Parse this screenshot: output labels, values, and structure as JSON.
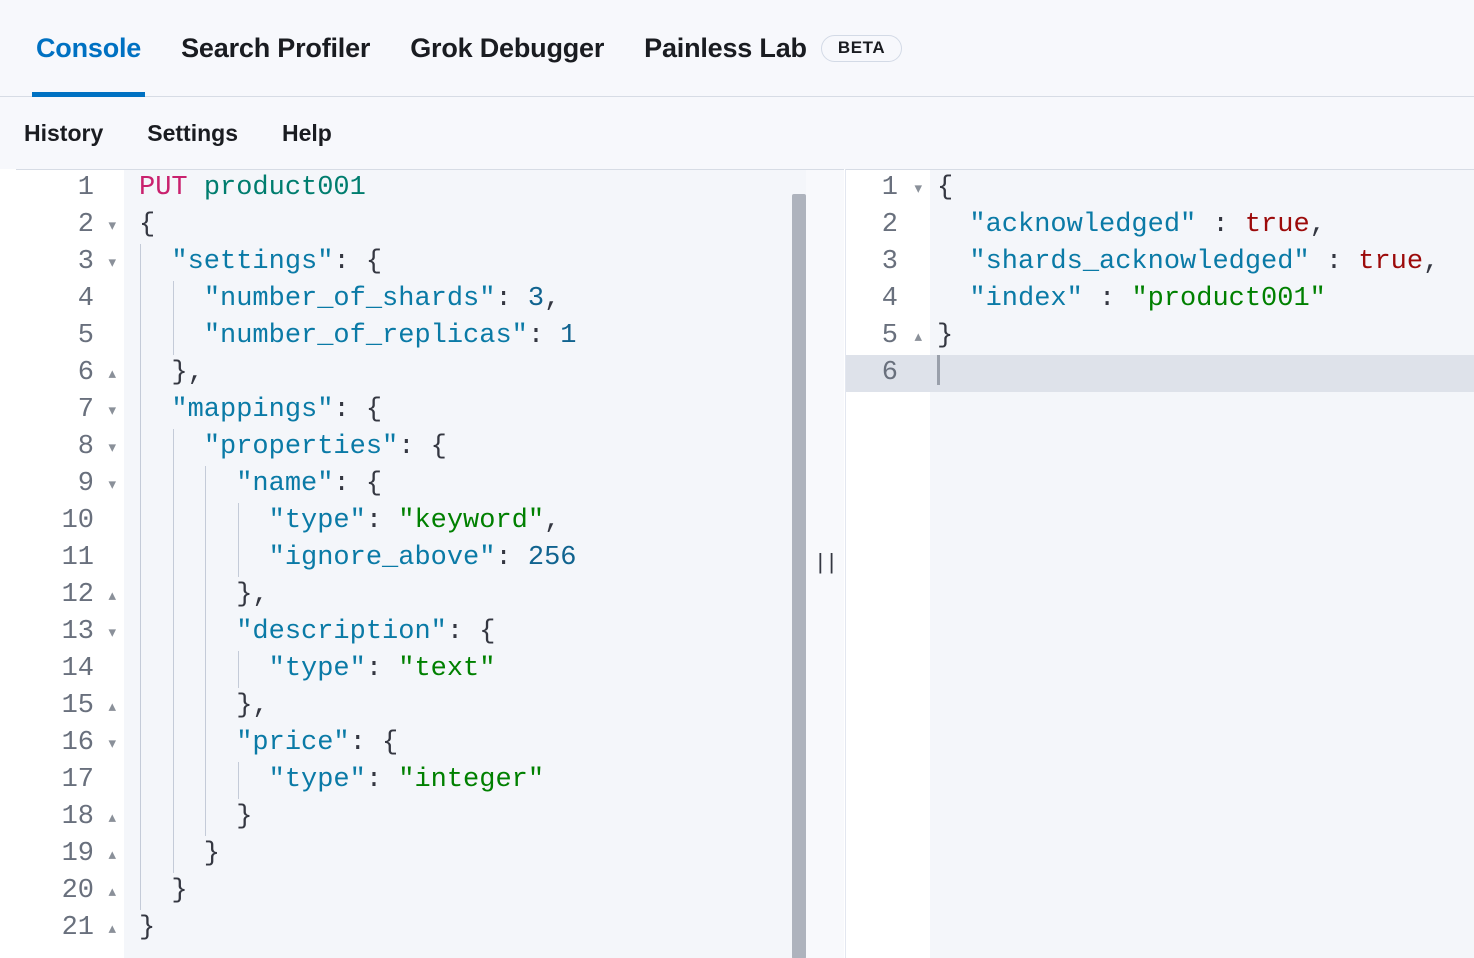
{
  "tabs": [
    {
      "label": "Console",
      "active": true,
      "badge": null
    },
    {
      "label": "Search Profiler",
      "active": false,
      "badge": null
    },
    {
      "label": "Grok Debugger",
      "active": false,
      "badge": null
    },
    {
      "label": "Painless Lab",
      "active": false,
      "badge": "BETA"
    }
  ],
  "subnav": [
    {
      "label": "History"
    },
    {
      "label": "Settings"
    },
    {
      "label": "Help"
    }
  ],
  "colors": {
    "accent": "#0071c2",
    "method": "#c9216e",
    "url": "#007d6e",
    "key": "#0a7aa6",
    "string": "#008000",
    "number": "#10638f",
    "boolean": "#9c0a0a",
    "punctuation": "#343741",
    "editor_background": "#f4f6fa",
    "gutter_background": "#ffffff",
    "active_line": "#dee2ea",
    "scrollbar_thumb": "#aeb3bd"
  },
  "request_editor": {
    "name": "console-request-editor",
    "lines": [
      {
        "n": "1",
        "fold": "",
        "indent": 0,
        "text": "PUT product001",
        "tokens": [
          {
            "t": "PUT",
            "c": "t-method"
          },
          {
            "t": " ",
            "c": "t-punct"
          },
          {
            "t": "product001",
            "c": "t-url"
          }
        ]
      },
      {
        "n": "2",
        "fold": "▾",
        "indent": 0,
        "text": "{",
        "tokens": [
          {
            "t": "{",
            "c": "t-punct"
          }
        ]
      },
      {
        "n": "3",
        "fold": "▾",
        "indent": 1,
        "text": "  \"settings\": {",
        "tokens": [
          {
            "t": "  ",
            "c": "t-punct"
          },
          {
            "t": "\"settings\"",
            "c": "t-key"
          },
          {
            "t": ": {",
            "c": "t-punct"
          }
        ]
      },
      {
        "n": "4",
        "fold": "",
        "indent": 2,
        "text": "    \"number_of_shards\": 3,",
        "tokens": [
          {
            "t": "    ",
            "c": "t-punct"
          },
          {
            "t": "\"number_of_shards\"",
            "c": "t-key"
          },
          {
            "t": ": ",
            "c": "t-punct"
          },
          {
            "t": "3",
            "c": "t-number"
          },
          {
            "t": ",",
            "c": "t-punct"
          }
        ]
      },
      {
        "n": "5",
        "fold": "",
        "indent": 2,
        "text": "    \"number_of_replicas\": 1",
        "tokens": [
          {
            "t": "    ",
            "c": "t-punct"
          },
          {
            "t": "\"number_of_replicas\"",
            "c": "t-key"
          },
          {
            "t": ": ",
            "c": "t-punct"
          },
          {
            "t": "1",
            "c": "t-number"
          }
        ]
      },
      {
        "n": "6",
        "fold": "▴",
        "indent": 1,
        "text": "  },",
        "tokens": [
          {
            "t": "  },",
            "c": "t-punct"
          }
        ]
      },
      {
        "n": "7",
        "fold": "▾",
        "indent": 1,
        "text": "  \"mappings\": {",
        "tokens": [
          {
            "t": "  ",
            "c": "t-punct"
          },
          {
            "t": "\"mappings\"",
            "c": "t-key"
          },
          {
            "t": ": {",
            "c": "t-punct"
          }
        ]
      },
      {
        "n": "8",
        "fold": "▾",
        "indent": 2,
        "text": "    \"properties\": {",
        "tokens": [
          {
            "t": "    ",
            "c": "t-punct"
          },
          {
            "t": "\"properties\"",
            "c": "t-key"
          },
          {
            "t": ": {",
            "c": "t-punct"
          }
        ]
      },
      {
        "n": "9",
        "fold": "▾",
        "indent": 3,
        "text": "      \"name\": {",
        "tokens": [
          {
            "t": "      ",
            "c": "t-punct"
          },
          {
            "t": "\"name\"",
            "c": "t-key"
          },
          {
            "t": ": {",
            "c": "t-punct"
          }
        ]
      },
      {
        "n": "10",
        "fold": "",
        "indent": 4,
        "text": "        \"type\": \"keyword\",",
        "tokens": [
          {
            "t": "        ",
            "c": "t-punct"
          },
          {
            "t": "\"type\"",
            "c": "t-key"
          },
          {
            "t": ": ",
            "c": "t-punct"
          },
          {
            "t": "\"keyword\"",
            "c": "t-string"
          },
          {
            "t": ",",
            "c": "t-punct"
          }
        ]
      },
      {
        "n": "11",
        "fold": "",
        "indent": 4,
        "text": "        \"ignore_above\": 256",
        "tokens": [
          {
            "t": "        ",
            "c": "t-punct"
          },
          {
            "t": "\"ignore_above\"",
            "c": "t-key"
          },
          {
            "t": ": ",
            "c": "t-punct"
          },
          {
            "t": "256",
            "c": "t-number"
          }
        ]
      },
      {
        "n": "12",
        "fold": "▴",
        "indent": 3,
        "text": "      },",
        "tokens": [
          {
            "t": "      },",
            "c": "t-punct"
          }
        ]
      },
      {
        "n": "13",
        "fold": "▾",
        "indent": 3,
        "text": "      \"description\": {",
        "tokens": [
          {
            "t": "      ",
            "c": "t-punct"
          },
          {
            "t": "\"description\"",
            "c": "t-key"
          },
          {
            "t": ": {",
            "c": "t-punct"
          }
        ]
      },
      {
        "n": "14",
        "fold": "",
        "indent": 4,
        "text": "        \"type\": \"text\"",
        "tokens": [
          {
            "t": "        ",
            "c": "t-punct"
          },
          {
            "t": "\"type\"",
            "c": "t-key"
          },
          {
            "t": ": ",
            "c": "t-punct"
          },
          {
            "t": "\"text\"",
            "c": "t-string"
          }
        ]
      },
      {
        "n": "15",
        "fold": "▴",
        "indent": 3,
        "text": "      },",
        "tokens": [
          {
            "t": "      },",
            "c": "t-punct"
          }
        ]
      },
      {
        "n": "16",
        "fold": "▾",
        "indent": 3,
        "text": "      \"price\": {",
        "tokens": [
          {
            "t": "      ",
            "c": "t-punct"
          },
          {
            "t": "\"price\"",
            "c": "t-key"
          },
          {
            "t": ": {",
            "c": "t-punct"
          }
        ]
      },
      {
        "n": "17",
        "fold": "",
        "indent": 4,
        "text": "        \"type\": \"integer\"",
        "tokens": [
          {
            "t": "        ",
            "c": "t-punct"
          },
          {
            "t": "\"type\"",
            "c": "t-key"
          },
          {
            "t": ": ",
            "c": "t-punct"
          },
          {
            "t": "\"integer\"",
            "c": "t-string"
          }
        ]
      },
      {
        "n": "18",
        "fold": "▴",
        "indent": 3,
        "text": "      }",
        "tokens": [
          {
            "t": "      }",
            "c": "t-punct"
          }
        ]
      },
      {
        "n": "19",
        "fold": "▴",
        "indent": 2,
        "text": "    }",
        "tokens": [
          {
            "t": "    }",
            "c": "t-punct"
          }
        ]
      },
      {
        "n": "20",
        "fold": "▴",
        "indent": 1,
        "text": "  }",
        "tokens": [
          {
            "t": "  }",
            "c": "t-punct"
          }
        ]
      },
      {
        "n": "21",
        "fold": "▴",
        "indent": 0,
        "text": "}",
        "tokens": [
          {
            "t": "}",
            "c": "t-punct"
          }
        ]
      }
    ]
  },
  "response_editor": {
    "name": "console-response-editor",
    "lines": [
      {
        "n": "1",
        "fold": "▾",
        "active": false,
        "caret": false,
        "text": "{",
        "tokens": [
          {
            "t": "{",
            "c": "t-punct"
          }
        ]
      },
      {
        "n": "2",
        "fold": "",
        "active": false,
        "caret": false,
        "text": "  \"acknowledged\" : true,",
        "tokens": [
          {
            "t": "  ",
            "c": "t-punct"
          },
          {
            "t": "\"acknowledged\"",
            "c": "t-key"
          },
          {
            "t": " : ",
            "c": "t-punct"
          },
          {
            "t": "true",
            "c": "t-bool"
          },
          {
            "t": ",",
            "c": "t-punct"
          }
        ]
      },
      {
        "n": "3",
        "fold": "",
        "active": false,
        "caret": false,
        "text": "  \"shards_acknowledged\" : true,",
        "tokens": [
          {
            "t": "  ",
            "c": "t-punct"
          },
          {
            "t": "\"shards_acknowledged\"",
            "c": "t-key"
          },
          {
            "t": " : ",
            "c": "t-punct"
          },
          {
            "t": "true",
            "c": "t-bool"
          },
          {
            "t": ",",
            "c": "t-punct"
          }
        ]
      },
      {
        "n": "4",
        "fold": "",
        "active": false,
        "caret": false,
        "text": "  \"index\" : \"product001\"",
        "tokens": [
          {
            "t": "  ",
            "c": "t-punct"
          },
          {
            "t": "\"index\"",
            "c": "t-key"
          },
          {
            "t": " : ",
            "c": "t-punct"
          },
          {
            "t": "\"product001\"",
            "c": "t-string"
          }
        ]
      },
      {
        "n": "5",
        "fold": "▴",
        "active": false,
        "caret": false,
        "text": "}",
        "tokens": [
          {
            "t": "}",
            "c": "t-punct"
          }
        ]
      },
      {
        "n": "6",
        "fold": "",
        "active": true,
        "caret": true,
        "text": "",
        "tokens": []
      }
    ]
  },
  "splitter": {
    "grip": "||"
  },
  "scrollbar": {
    "name": "request-vertical-scrollbar"
  }
}
